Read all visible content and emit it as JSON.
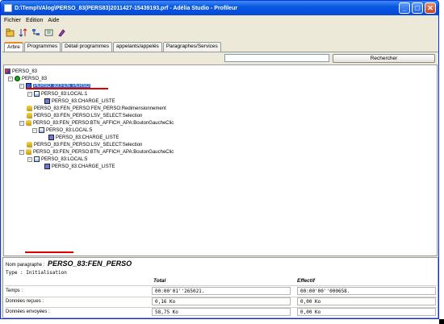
{
  "window": {
    "title": "D:\\Temp\\VAlog\\PERSO_83(PERS83)2011427-15439193.prf - Adélia Studio - Profileur",
    "controls": {
      "minimize": "_",
      "maximize": "□",
      "close": "✕"
    }
  },
  "menu": {
    "items": [
      "Fichier",
      "Edition",
      "Aide"
    ]
  },
  "toolbar": {
    "icons": [
      "open-icon",
      "sort-icon",
      "tree-icon",
      "tools-icon",
      "help-icon"
    ]
  },
  "tabs": [
    "Arbre",
    "Programmes",
    "Détail programmes",
    "appelants/appelés",
    "Paragraphes/Services"
  ],
  "search": {
    "placeholder": "",
    "button_label": "Rechercher"
  },
  "tree": [
    {
      "label": "PERSO_83",
      "icon": "application-icon",
      "expander": ""
    },
    {
      "label": "PERSO_83",
      "icon": "program-icon",
      "expander": "−"
    },
    {
      "label": "PERSO_83:FEN_PERSO",
      "icon": "window-icon",
      "expander": "−",
      "selected": true
    },
    {
      "label": "PERSO_83:LOCAL:1",
      "icon": "local-icon",
      "expander": "−"
    },
    {
      "label": "PERSO_83:CHARGE_LISTE",
      "icon": "procedure-icon",
      "expander": ""
    },
    {
      "label": "PERSO_83:FEN_PERSO:FEN_PERSO:Redimensionnement",
      "icon": "event-icon",
      "expander": ""
    },
    {
      "label": "PERSO_83:FEN_PERSO:LSV_SELECT:Selection",
      "icon": "event-icon",
      "expander": ""
    },
    {
      "label": "PERSO_83:FEN_PERSO:BTN_AFFICH_APA:BoutonGaucheClic",
      "icon": "event-icon",
      "expander": "−"
    },
    {
      "label": "PERSO_83:LOCAL:5",
      "icon": "local-icon",
      "expander": "−"
    },
    {
      "label": "PERSO_83:CHARGE_LISTE",
      "icon": "procedure-icon",
      "expander": ""
    },
    {
      "label": "PERSO_83:FEN_PERSO:LSV_SELECT:Selection",
      "icon": "event-icon",
      "expander": ""
    },
    {
      "label": "PERSO_83:FEN_PERSO:BTN_AFFICH_APA:BoutonGaucheClic",
      "icon": "event-icon",
      "expander": "−"
    },
    {
      "label": "PERSO_83:LOCAL:5",
      "icon": "local-icon",
      "expander": "−"
    },
    {
      "label": "PERSO_83:CHARGE_LISTE",
      "icon": "procedure-icon",
      "expander": ""
    }
  ],
  "info": {
    "para_label": "Nom paragraphe :",
    "para_value": "PERSO_83:FEN_PERSO",
    "type_line": "Type : Initialisation",
    "col_total": "Total",
    "col_effectif": "Effectif",
    "rows": [
      {
        "label": "Temps :",
        "total": "00:00'01''265021.",
        "effectif": "00:00'00''000658."
      },
      {
        "label": "Données reçues :",
        "total": "0,16 Ko",
        "effectif": "0,00 Ko"
      },
      {
        "label": "Données envoyées :",
        "total": "58,75 Ko",
        "effectif": "0,00 Ko"
      }
    ]
  },
  "colors": {
    "accent": "#316ac5",
    "annotation": "#e00000",
    "titlebar": "#0a58e0"
  }
}
